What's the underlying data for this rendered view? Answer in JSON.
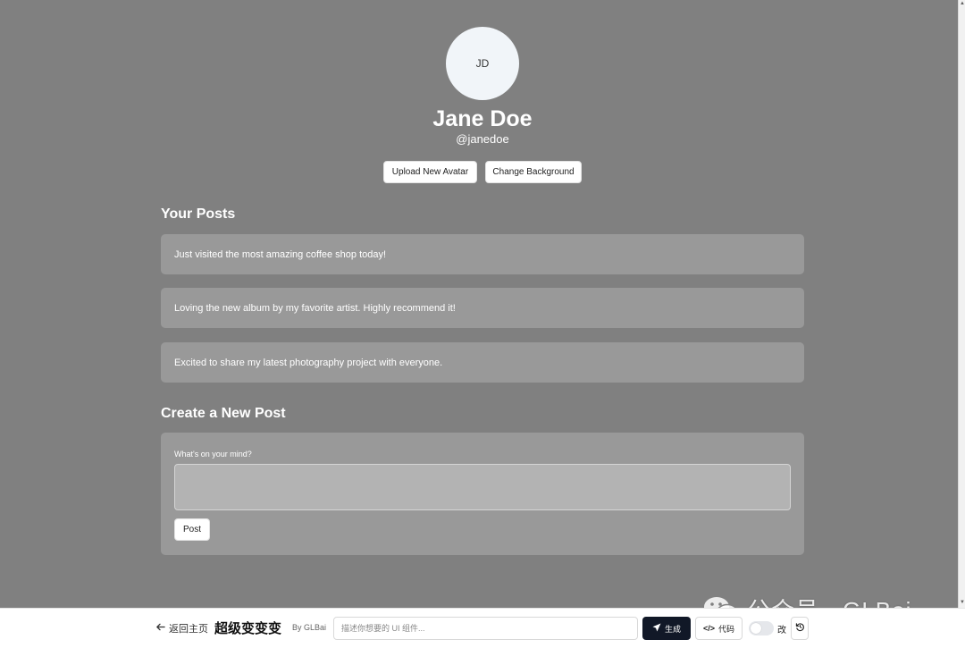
{
  "profile": {
    "initials": "JD",
    "name": "Jane Doe",
    "handle": "@janedoe",
    "upload_avatar_label": "Upload New Avatar",
    "change_background_label": "Change Background"
  },
  "posts": {
    "title": "Your Posts",
    "items": [
      {
        "text": "Just visited the most amazing coffee shop today!"
      },
      {
        "text": "Loving the new album by my favorite artist. Highly recommend it!"
      },
      {
        "text": "Excited to share my latest photography project with everyone."
      }
    ]
  },
  "create_post": {
    "title": "Create a New Post",
    "label": "What's on your mind?",
    "value": "",
    "post_label": "Post"
  },
  "toolbar": {
    "back_label": "返回主页",
    "app_title": "超级变变变",
    "author": "By GLBai",
    "prompt_placeholder": "描述你想要的 UI 组件...",
    "generate_label": "生成",
    "code_label": "代码",
    "edit_label": "改"
  },
  "watermark": {
    "text": "公众号 · GLBai"
  },
  "colors": {
    "page_background": "#808080",
    "card_background": "#999999",
    "input_background": "#b3b3b3",
    "generate_button": "#111827"
  }
}
